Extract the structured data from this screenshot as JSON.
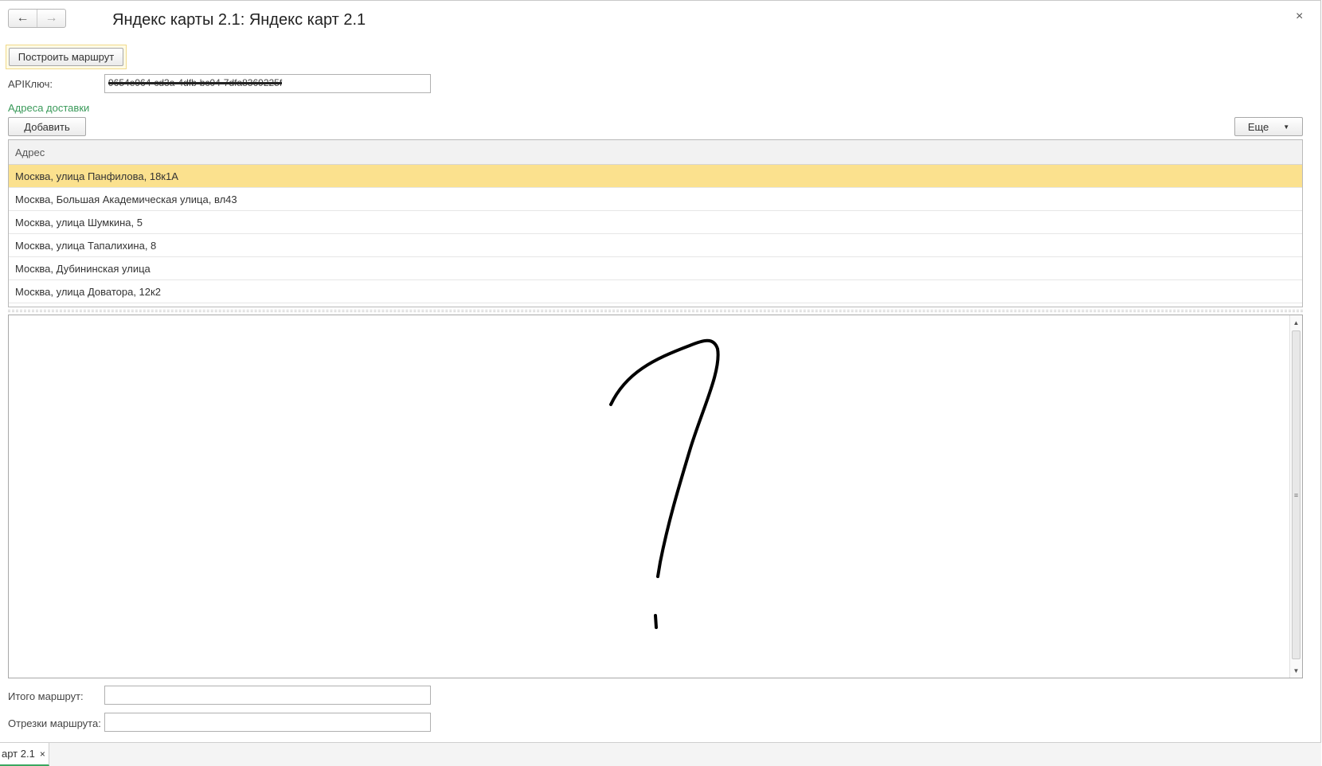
{
  "window": {
    "title": "Яндекс карты 2.1: Яндекс карт 2.1",
    "back_icon": "←",
    "forward_icon": "→",
    "close_icon": "×"
  },
  "toolbar": {
    "route_button": "Построить маршрут"
  },
  "api_key": {
    "label": "APIКлюч:",
    "value": "9654e964-cd3a-4dfb-bc04-7dfa8369225f"
  },
  "addresses": {
    "group_title": "Адреса доставки",
    "add_button": "Добавить",
    "more_button": "Еще",
    "more_arrow": "▼",
    "column_header": "Адрес",
    "rows": [
      "Москва, улица Панфилова, 18к1А",
      "Москва, Большая Академическая улица, вл43",
      "Москва, улица Шумкина, 5",
      "Москва, улица Тапалихина, 8",
      "Москва, Дубининская улица",
      "Москва, улица Доватора, 12к2"
    ],
    "selected_index": 0
  },
  "map_area": {
    "scroll_up": "▲",
    "scroll_down": "▼",
    "scroll_grip": "≡"
  },
  "route_total": {
    "label": "Итого маршрут:",
    "value": ""
  },
  "route_segments": {
    "label": "Отрезки маршрута:",
    "value": ""
  },
  "taskbar": {
    "tab_label": "арт 2.1",
    "tab_close": "×"
  },
  "colors": {
    "selected_row": "#fbe18e",
    "group_title": "#3a9a5a",
    "active_tab_underline": "#3aa860"
  }
}
